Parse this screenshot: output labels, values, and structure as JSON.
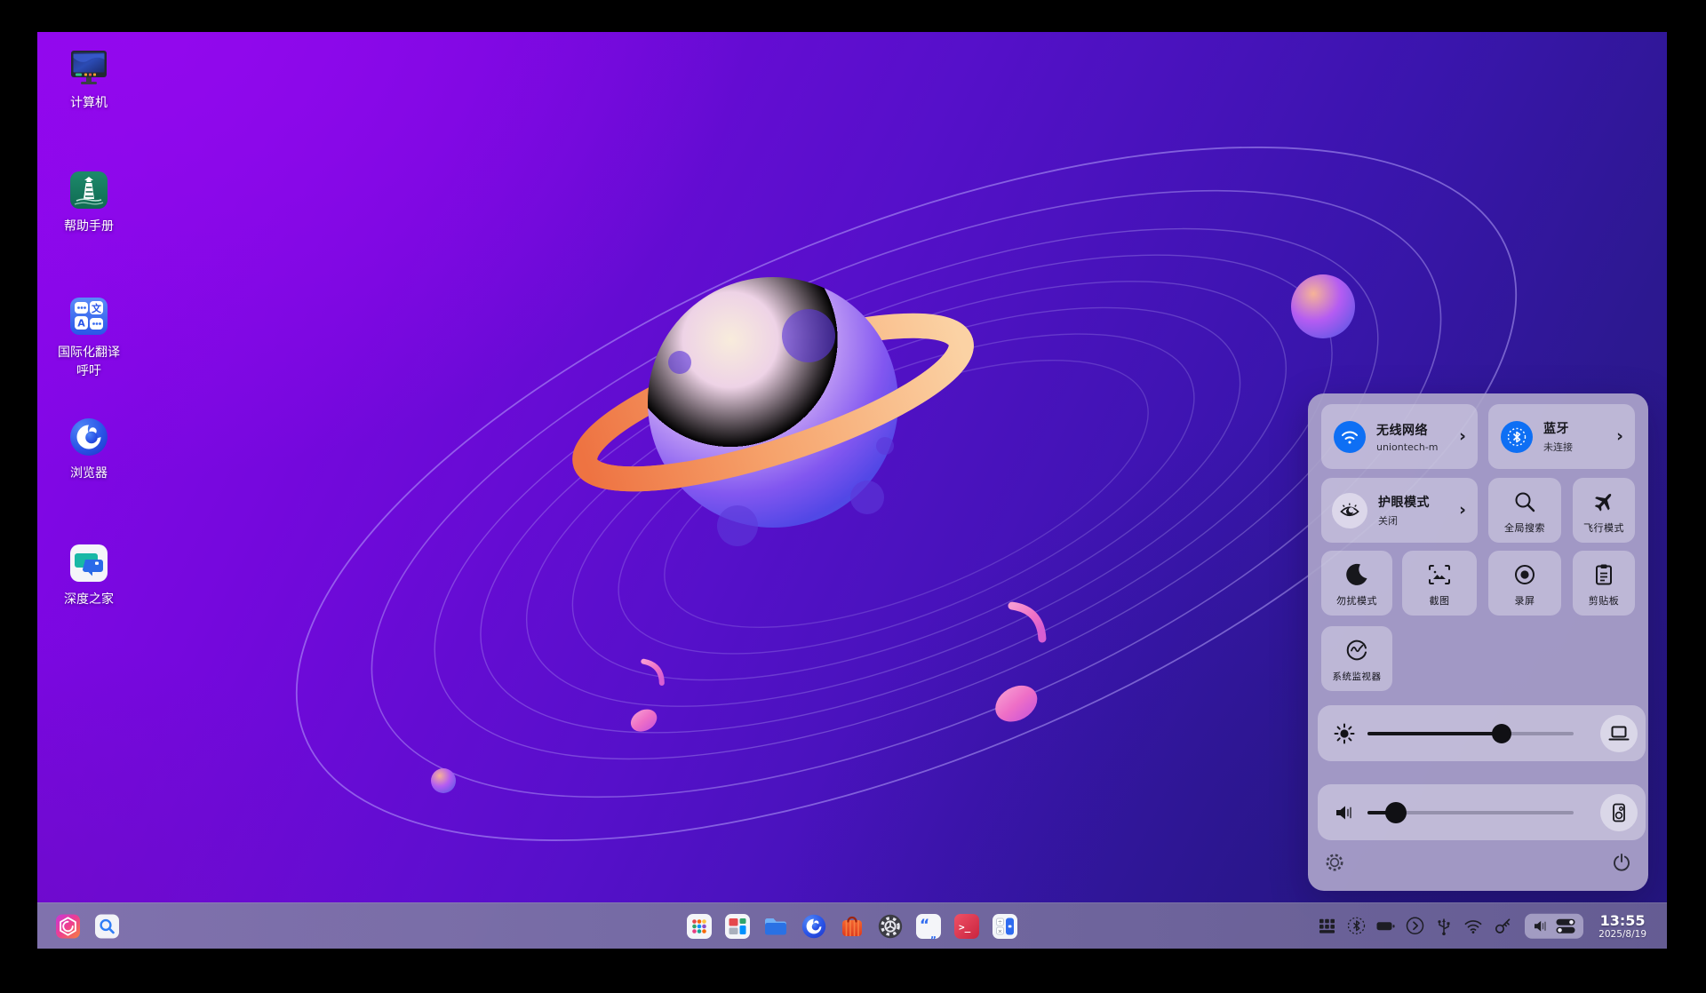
{
  "desktop": {
    "icons": [
      {
        "label": "计算机",
        "icon": "computer-icon"
      },
      {
        "label": "帮助手册",
        "icon": "help-manual-icon"
      },
      {
        "label": "国际化翻译呼吁",
        "icon": "translator-icon"
      },
      {
        "label": "浏览器",
        "icon": "browser-icon"
      },
      {
        "label": "深度之家",
        "icon": "deepin-home-icon"
      }
    ]
  },
  "control_center": {
    "wifi": {
      "title": "无线网络",
      "subtitle": "uniontech-m",
      "icon": "wifi-icon",
      "chevron": "›"
    },
    "bluetooth": {
      "title": "蓝牙",
      "subtitle": "未连接",
      "icon": "bluetooth-icon",
      "chevron": "›"
    },
    "eye_protection": {
      "title": "护眼模式",
      "subtitle": "关闭",
      "icon": "eye-icon",
      "chevron": "›"
    },
    "global_search": {
      "label": "全局搜索",
      "icon": "search-icon"
    },
    "airplane_mode": {
      "label": "飞行模式",
      "icon": "airplane-icon"
    },
    "dnd_mode": {
      "label": "勿扰模式",
      "icon": "moon-icon"
    },
    "screenshot": {
      "label": "截图",
      "icon": "screenshot-icon"
    },
    "screen_record": {
      "label": "录屏",
      "icon": "record-icon"
    },
    "clipboard": {
      "label": "剪贴板",
      "icon": "clipboard-icon"
    },
    "system_monitor": {
      "label": "系统监视器",
      "icon": "monitor-gauge-icon"
    },
    "brightness": {
      "icon": "sun-icon",
      "device_icon": "laptop-icon",
      "value_pct": 65
    },
    "volume": {
      "icon": "speaker-icon",
      "device_icon": "speaker-box-icon",
      "value_pct": 14
    },
    "footer": {
      "left_icon": "settings-icon",
      "right_icon": "power-icon"
    }
  },
  "taskbar": {
    "launcher": {
      "icon": "launcher-logo-icon"
    },
    "search": {
      "icon": "search-app-icon"
    },
    "dock": [
      {
        "name": "all-apps-grid-icon"
      },
      {
        "name": "multitasking-view-icon"
      },
      {
        "name": "file-manager-icon"
      },
      {
        "name": "browser-dock-icon"
      },
      {
        "name": "app-store-icon"
      },
      {
        "name": "control-center-gear-icon"
      },
      {
        "name": "voice-notes-icon"
      },
      {
        "name": "terminal-icon"
      },
      {
        "name": "calculator-icon"
      }
    ],
    "tray": {
      "icons": [
        "onboard-keyboard-icon",
        "bluetooth-tray-icon",
        "battery-icon",
        "expand-chevron-icon",
        "usb-icon",
        "wifi-tray-icon",
        "keyring-icon"
      ],
      "sound_group": [
        "speaker-tray-icon",
        "toggles-icon"
      ],
      "clock": {
        "time": "13:55",
        "date": "2025/8/19"
      }
    }
  },
  "colors": {
    "accent_blue": "#0e6ff4",
    "wallpaper_top_left": "#8b06ec",
    "wallpaper_bottom_right": "#27177e",
    "ring_orange": "#ef7b4a",
    "panel_bg": "#aba4ca",
    "taskbar_bg": "#6f6699"
  }
}
